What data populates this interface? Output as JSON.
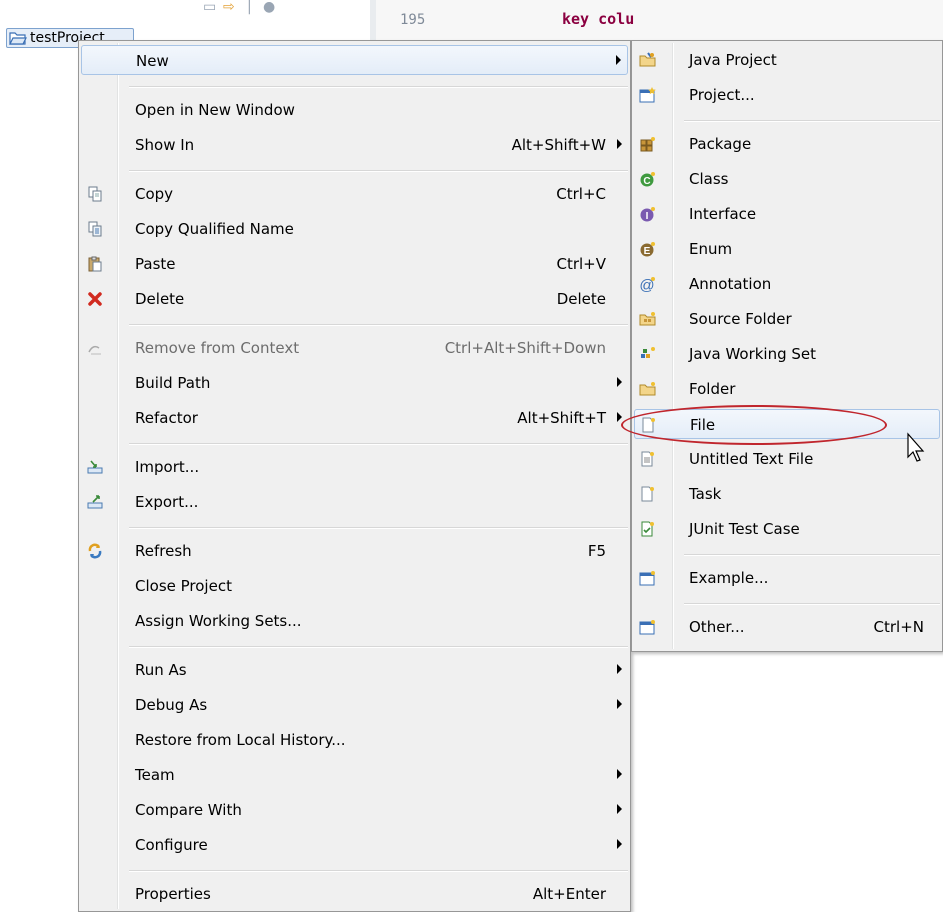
{
  "background": {
    "line_number": "195",
    "code_text": "key colu",
    "project_node_label": "testProject"
  },
  "context_menu": {
    "items": [
      {
        "label": "New",
        "shortcut": "",
        "submenu": true,
        "icon": ""
      },
      {
        "label": "Open in New Window",
        "shortcut": "",
        "submenu": false,
        "icon": ""
      },
      {
        "label": "Show In",
        "shortcut": "Alt+Shift+W",
        "submenu": true,
        "icon": ""
      },
      {
        "label": "Copy",
        "shortcut": "Ctrl+C",
        "submenu": false,
        "icon": "copy-icon"
      },
      {
        "label": "Copy Qualified Name",
        "shortcut": "",
        "submenu": false,
        "icon": "copy-qualified-name-icon"
      },
      {
        "label": "Paste",
        "shortcut": "Ctrl+V",
        "submenu": false,
        "icon": "paste-icon"
      },
      {
        "label": "Delete",
        "shortcut": "Delete",
        "submenu": false,
        "icon": "delete-icon"
      },
      {
        "label": "Remove from Context",
        "shortcut": "Ctrl+Alt+Shift+Down",
        "submenu": false,
        "icon": "remove-context-icon",
        "disabled": true
      },
      {
        "label": "Build Path",
        "shortcut": "",
        "submenu": true,
        "icon": ""
      },
      {
        "label": "Refactor",
        "shortcut": "Alt+Shift+T",
        "submenu": true,
        "icon": ""
      },
      {
        "label": "Import...",
        "shortcut": "",
        "submenu": false,
        "icon": "import-icon"
      },
      {
        "label": "Export...",
        "shortcut": "",
        "submenu": false,
        "icon": "export-icon"
      },
      {
        "label": "Refresh",
        "shortcut": "F5",
        "submenu": false,
        "icon": "refresh-icon"
      },
      {
        "label": "Close Project",
        "shortcut": "",
        "submenu": false,
        "icon": ""
      },
      {
        "label": "Assign Working Sets...",
        "shortcut": "",
        "submenu": false,
        "icon": ""
      },
      {
        "label": "Run As",
        "shortcut": "",
        "submenu": true,
        "icon": ""
      },
      {
        "label": "Debug As",
        "shortcut": "",
        "submenu": true,
        "icon": ""
      },
      {
        "label": "Restore from Local History...",
        "shortcut": "",
        "submenu": false,
        "icon": ""
      },
      {
        "label": "Team",
        "shortcut": "",
        "submenu": true,
        "icon": ""
      },
      {
        "label": "Compare With",
        "shortcut": "",
        "submenu": true,
        "icon": ""
      },
      {
        "label": "Configure",
        "shortcut": "",
        "submenu": true,
        "icon": ""
      },
      {
        "label": "Properties",
        "shortcut": "Alt+Enter",
        "submenu": false,
        "icon": ""
      }
    ]
  },
  "new_submenu": {
    "items": [
      {
        "label": "Java Project",
        "shortcut": "",
        "icon": "java-project-icon"
      },
      {
        "label": "Project...",
        "shortcut": "",
        "icon": "project-icon"
      },
      {
        "label": "Package",
        "shortcut": "",
        "icon": "package-icon"
      },
      {
        "label": "Class",
        "shortcut": "",
        "icon": "class-icon"
      },
      {
        "label": "Interface",
        "shortcut": "",
        "icon": "interface-icon"
      },
      {
        "label": "Enum",
        "shortcut": "",
        "icon": "enum-icon"
      },
      {
        "label": "Annotation",
        "shortcut": "",
        "icon": "annotation-icon"
      },
      {
        "label": "Source Folder",
        "shortcut": "",
        "icon": "source-folder-icon"
      },
      {
        "label": "Java Working Set",
        "shortcut": "",
        "icon": "java-working-set-icon"
      },
      {
        "label": "Folder",
        "shortcut": "",
        "icon": "folder-icon"
      },
      {
        "label": "File",
        "shortcut": "",
        "icon": "file-icon",
        "highlighted": true
      },
      {
        "label": "Untitled Text File",
        "shortcut": "",
        "icon": "untitled-text-file-icon"
      },
      {
        "label": "Task",
        "shortcut": "",
        "icon": "task-icon"
      },
      {
        "label": "JUnit Test Case",
        "shortcut": "",
        "icon": "junit-test-case-icon"
      },
      {
        "label": "Example...",
        "shortcut": "",
        "icon": "example-icon"
      },
      {
        "label": "Other...",
        "shortcut": "Ctrl+N",
        "icon": "other-icon"
      }
    ]
  },
  "colors": {
    "menu_bg": "#f0f0f0",
    "hover_border": "#a8c4e6",
    "annotation_red": "#c0262d",
    "code_keyword": "#8b0040"
  }
}
